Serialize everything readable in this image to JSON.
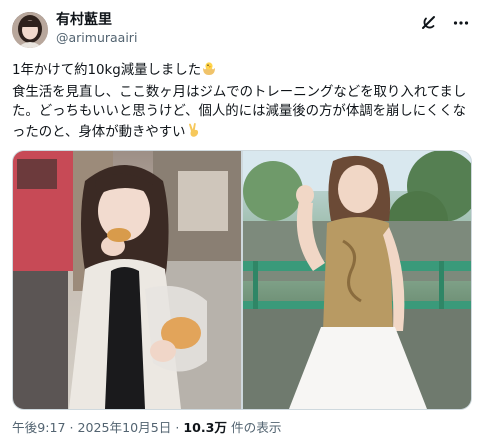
{
  "author": {
    "display_name": "有村藍里",
    "handle": "@arimuraairi",
    "avatar_icon": "avatar-photo"
  },
  "actions": {
    "grok_icon": "grok-icon",
    "more_icon": "more-icon"
  },
  "post": {
    "line1": "1年かけて約10kg減量しました",
    "line1_emoji": "chick-emoji",
    "line2": "食生活を見直し、ここ数ヶ月はジムでのトレーニングなどを取り入れてました。どっちもいいと思うけど、個人的には減量後の方が体調を崩しにくくなったのと、身体が動きやすい",
    "line2_emoji": "victory-hand-emoji"
  },
  "media": [
    {
      "icon": "photo-before"
    },
    {
      "icon": "photo-after"
    }
  ],
  "meta": {
    "time": "午後9:17 · 2025年10月5日 · ",
    "views_count": "10.3万",
    "views_label": " 件の表示"
  }
}
